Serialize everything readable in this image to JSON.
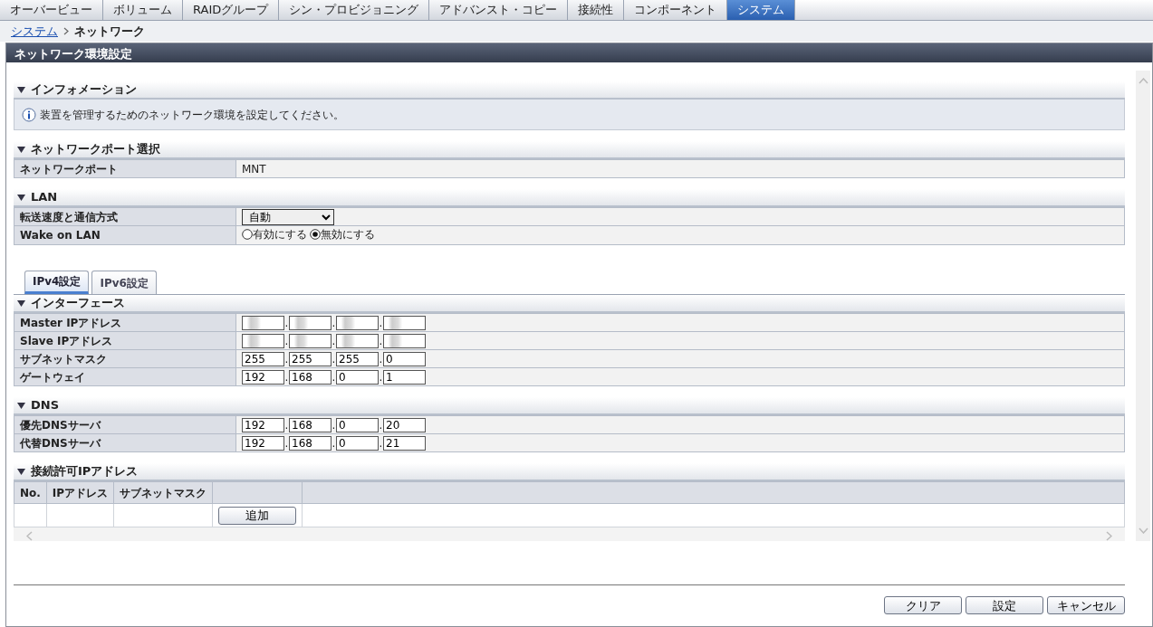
{
  "top_tabs": [
    {
      "label": "オーバービュー",
      "selected": false
    },
    {
      "label": "ボリューム",
      "selected": false
    },
    {
      "label": "RAIDグループ",
      "selected": false
    },
    {
      "label": "シン・プロビジョニング",
      "selected": false
    },
    {
      "label": "アドバンスト・コピー",
      "selected": false
    },
    {
      "label": "接続性",
      "selected": false
    },
    {
      "label": "コンポーネント",
      "selected": false
    },
    {
      "label": "システム",
      "selected": true
    }
  ],
  "breadcrumb": {
    "link": "システム",
    "current": "ネットワーク"
  },
  "panel_title": "ネットワーク環境設定",
  "sections": [
    {
      "kind": "info",
      "title": "インフォメーション",
      "message": "装置を管理するためのネットワーク環境を設定してください。"
    },
    {
      "kind": "table",
      "title": "ネットワークポート選択",
      "rows": [
        {
          "kind": "text",
          "label": "ネットワークポート",
          "value": "MNT"
        }
      ]
    },
    {
      "kind": "table",
      "title": "LAN",
      "rows": [
        {
          "kind": "select",
          "label": "転送速度と通信方式",
          "value": "自動"
        },
        {
          "kind": "radio",
          "label": "Wake on LAN",
          "options": [
            {
              "label": "有効にする",
              "selected": false
            },
            {
              "label": "無効にする",
              "selected": true
            }
          ]
        }
      ]
    },
    {
      "kind": "tabs",
      "tabs": [
        {
          "label": "IPv4設定",
          "selected": true
        },
        {
          "label": "IPv6設定",
          "selected": false
        }
      ]
    },
    {
      "kind": "table",
      "title": "インターフェース",
      "rows": [
        {
          "kind": "ip",
          "label": "Master IPアドレス",
          "separator": ".",
          "octets": [
            {
              "masked": true
            },
            {
              "masked": true
            },
            {
              "masked": true
            },
            {
              "masked": true
            }
          ]
        },
        {
          "kind": "ip",
          "label": "Slave IPアドレス",
          "separator": ".",
          "octets": [
            {
              "masked": true
            },
            {
              "masked": true
            },
            {
              "masked": true
            },
            {
              "masked": true
            }
          ]
        },
        {
          "kind": "ip",
          "label": "サブネットマスク",
          "separator": ".",
          "octets": [
            {
              "value": "255",
              "masked": false
            },
            {
              "value": "255",
              "masked": false
            },
            {
              "value": "255",
              "masked": false
            },
            {
              "value": "0",
              "masked": false
            }
          ]
        },
        {
          "kind": "ip",
          "label": "ゲートウェイ",
          "separator": ".",
          "octets": [
            {
              "value": "192",
              "masked": false
            },
            {
              "value": "168",
              "masked": false
            },
            {
              "value": "0",
              "masked": false
            },
            {
              "value": "1",
              "masked": false
            }
          ]
        }
      ]
    },
    {
      "kind": "table",
      "title": "DNS",
      "rows": [
        {
          "kind": "ip",
          "label": "優先DNSサーバ",
          "separator": ".",
          "octets": [
            {
              "value": "192",
              "masked": false
            },
            {
              "value": "168",
              "masked": false
            },
            {
              "value": "0",
              "masked": false
            },
            {
              "value": "20",
              "masked": false
            }
          ]
        },
        {
          "kind": "ip",
          "label": "代替DNSサーバ",
          "separator": ".",
          "octets": [
            {
              "value": "192",
              "masked": false
            },
            {
              "value": "168",
              "masked": false
            },
            {
              "value": "0",
              "masked": false
            },
            {
              "value": "21",
              "masked": false
            }
          ]
        }
      ]
    },
    {
      "kind": "grid",
      "title": "接続許可IPアドレス",
      "columns": [
        "No.",
        "IPアドレス",
        "サブネットマスク"
      ],
      "add_button": "追加"
    }
  ],
  "buttons": [
    "クリア",
    "設定",
    "キャンセル"
  ]
}
